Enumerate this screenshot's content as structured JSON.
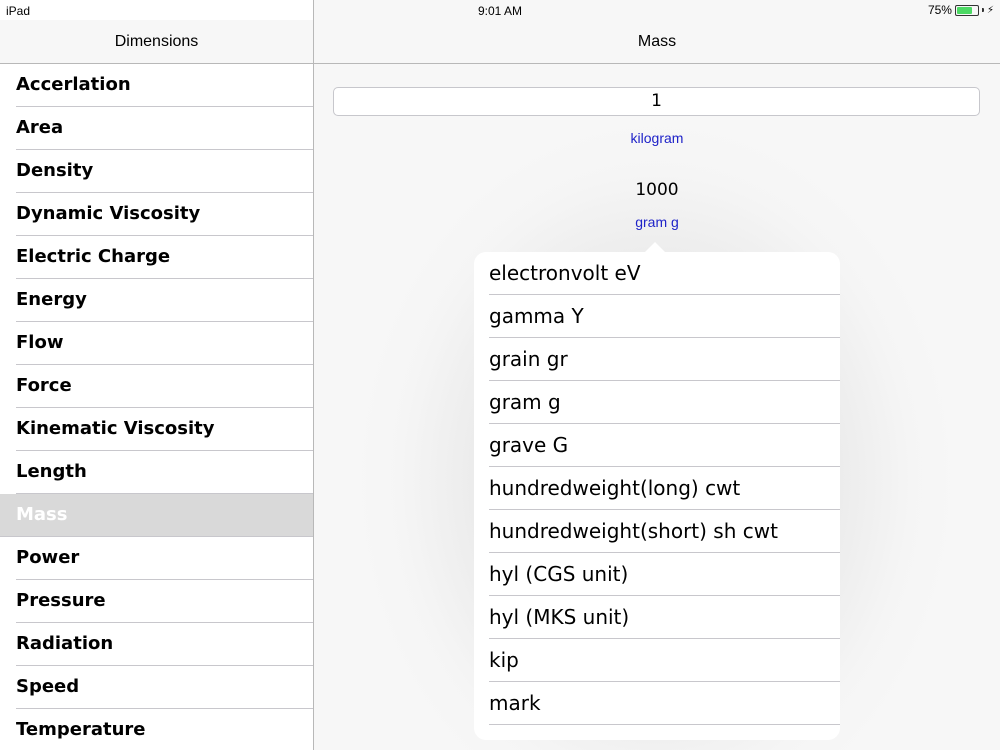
{
  "status_bar": {
    "device": "iPad",
    "time": "9:01 AM",
    "battery_text": "75%",
    "battery_level": 0.75,
    "charging_icon": "bolt-icon"
  },
  "master": {
    "title": "Dimensions",
    "items": [
      {
        "label": "Accerlation"
      },
      {
        "label": "Area"
      },
      {
        "label": "Density"
      },
      {
        "label": "Dynamic Viscosity"
      },
      {
        "label": "Electric Charge"
      },
      {
        "label": "Energy"
      },
      {
        "label": "Flow"
      },
      {
        "label": "Force"
      },
      {
        "label": "Kinematic Viscosity"
      },
      {
        "label": "Length"
      },
      {
        "label": "Mass",
        "selected": true
      },
      {
        "label": "Power"
      },
      {
        "label": "Pressure"
      },
      {
        "label": "Radiation"
      },
      {
        "label": "Speed"
      },
      {
        "label": "Temperature"
      }
    ]
  },
  "detail": {
    "title": "Mass",
    "input_value": "1",
    "from_unit": "kilogram",
    "result_value": "1000",
    "to_unit": "gram g",
    "unit_options": [
      "electronvolt eV",
      "gamma Y",
      "grain gr",
      "gram g",
      "grave G",
      "hundredweight(long) cwt",
      "hundredweight(short) sh cwt",
      "hyl (CGS unit)",
      "hyl (MKS unit)",
      "kip",
      "mark"
    ]
  },
  "colors": {
    "link_blue": "#1e22c8",
    "selected_row": "#d9d9d9",
    "battery_green": "#4cd964"
  }
}
